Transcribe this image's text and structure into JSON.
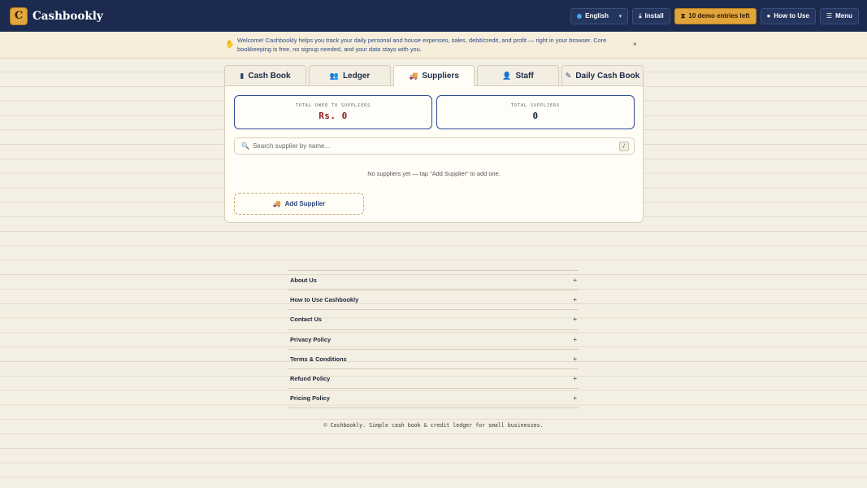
{
  "app": {
    "logo_letter": "C",
    "name": "Cashbookly"
  },
  "header": {
    "language": "English",
    "install_label": "Install",
    "demo_label": "10 demo entries left",
    "how_to_use_label": "How to Use",
    "menu_label": "Menu"
  },
  "welcome": {
    "text": "Welcome! Cashbookly helps you track your daily personal and house expenses, sales, debit/credit, and profit — right in your browser. Core bookkeeping is free, no signup needed, and your data stays with you.",
    "close": "×"
  },
  "tabs": [
    {
      "label": "Cash Book",
      "icon": "book-icon"
    },
    {
      "label": "Ledger",
      "icon": "users-icon"
    },
    {
      "label": "Suppliers",
      "icon": "truck-icon"
    },
    {
      "label": "Staff",
      "icon": "person-icon"
    },
    {
      "label": "Daily Cash Book",
      "icon": "edit-icon"
    }
  ],
  "active_tab": "Suppliers",
  "stats": {
    "owed_label": "TOTAL OWED TO SUPPLIERS",
    "owed_value": "Rs. 0",
    "count_label": "TOTAL SUPPLIERS",
    "count_value": "0"
  },
  "search": {
    "placeholder": "Search supplier by name...",
    "shortcut": "/"
  },
  "empty_message": "No suppliers yet — tap \"Add Supplier\" to add one.",
  "add_supplier_label": "Add Supplier",
  "footer": {
    "items": [
      "About Us",
      "How to Use Cashbookly",
      "Contact Us",
      "Privacy Policy",
      "Terms & Conditions",
      "Refund Policy",
      "Pricing Policy"
    ],
    "expand_symbol": "+",
    "copyright": "© Cashbookly. Simple cash book & credit ledger for small businesses."
  },
  "colors": {
    "header_bg": "#1b2a4e",
    "accent_gold": "#e0a43a",
    "accent_blue": "#2f4c95",
    "money_red": "#8b1a1a",
    "paper": "#f4efe3"
  }
}
